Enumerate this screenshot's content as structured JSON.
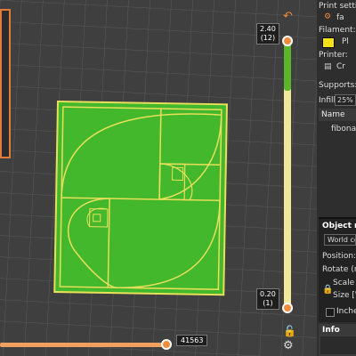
{
  "viewport": {
    "layer_top_value": "2.40",
    "layer_top_index": "(12)",
    "layer_bottom_value": "0.20",
    "layer_bottom_index": "(1)",
    "move_value": "41563"
  },
  "panel": {
    "print_settings_label": "Print setting",
    "print_settings_value": "fa",
    "filament_label": "Filament:",
    "filament_value": "Pl",
    "filament_color": "#f4e01a",
    "printer_label": "Printer:",
    "printer_value": "Cr",
    "supports_label": "Supports:",
    "infill_label": "Infill:",
    "infill_value": "25%",
    "list_header": "Name",
    "list_item": "fibonacc",
    "object_manip_title": "Object m",
    "world_coords": "World co",
    "position_label": "Position:",
    "rotate_label": "Rotate (rel",
    "scale_label": "Scale fa",
    "size_label": "Size [W",
    "inches_label": "Inches",
    "info_title": "Info"
  },
  "colors": {
    "model_fill": "#44b82c",
    "model_lines": "#e8e05a",
    "accent": "#f08a3c"
  },
  "icons": [
    "undo-icon",
    "lock-open-icon",
    "cog-icon",
    "filament-swatch",
    "printer-icon",
    "lock-icon"
  ]
}
